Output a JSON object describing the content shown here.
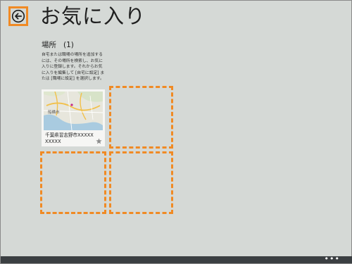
{
  "header": {
    "title": "お気に入り",
    "back_icon": "arrow-left-circle-icon"
  },
  "section": {
    "name": "場所",
    "count": "(1)",
    "description": "自宅または職場の場所を追加するには、その場所を検索し、お気に入りに登録します。それからお気に入りを編集して [自宅に設定] または [職場に設定] を選択します。"
  },
  "favorites": [
    {
      "map_label": "船橋市",
      "place_name": "千葉県習志野市XXXXX XXXXX",
      "star_icon": "star-icon"
    }
  ],
  "highlight_color": "#f08a24",
  "app_bar": {
    "more_label": "•••",
    "more_icon": "ellipsis-icon"
  }
}
